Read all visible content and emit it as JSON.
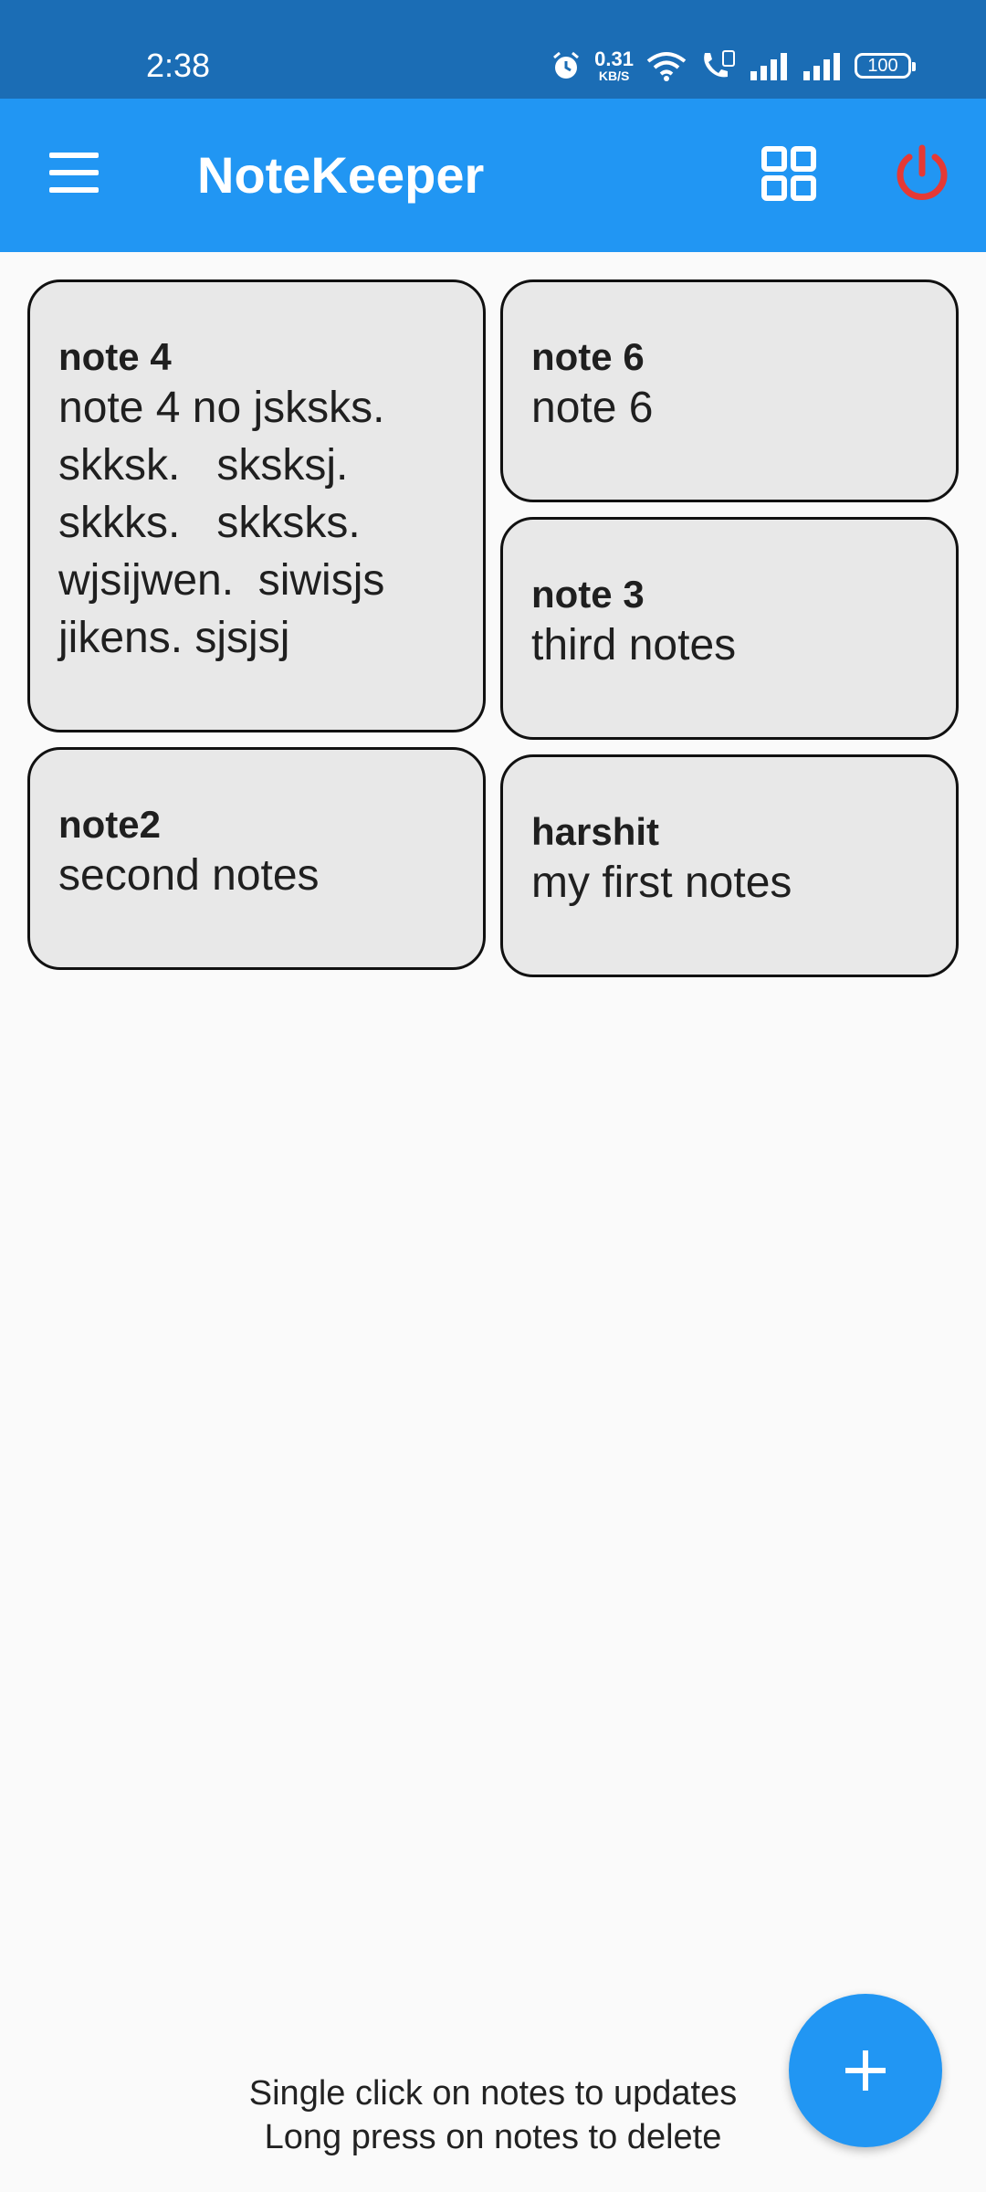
{
  "status_bar": {
    "time": "2:38",
    "net_speed_value": "0.31",
    "net_speed_unit": "KB/S",
    "battery": "100"
  },
  "app_bar": {
    "title": "NoteKeeper",
    "menu_icon": "hamburger-menu-icon",
    "grid_icon": "grid-view-icon",
    "power_icon": "power-icon",
    "accent": "#2196f3",
    "power_color": "#e53935"
  },
  "notes": [
    {
      "title": "note 4",
      "body": "note 4 no jsksks.  skksk.   sksksj.  skkks.   skksks.  wjsijwen.  siwisjs jikens. sjsjsj"
    },
    {
      "title": "note 6",
      "body": "note 6"
    },
    {
      "title": "note 3",
      "body": "third notes"
    },
    {
      "title": "note2",
      "body": "second notes"
    },
    {
      "title": "harshit",
      "body": "my first notes"
    }
  ],
  "hint": {
    "line1": "Single click on notes to updates",
    "line2": "Long press on notes to delete"
  },
  "fab": {
    "icon": "plus-icon"
  }
}
